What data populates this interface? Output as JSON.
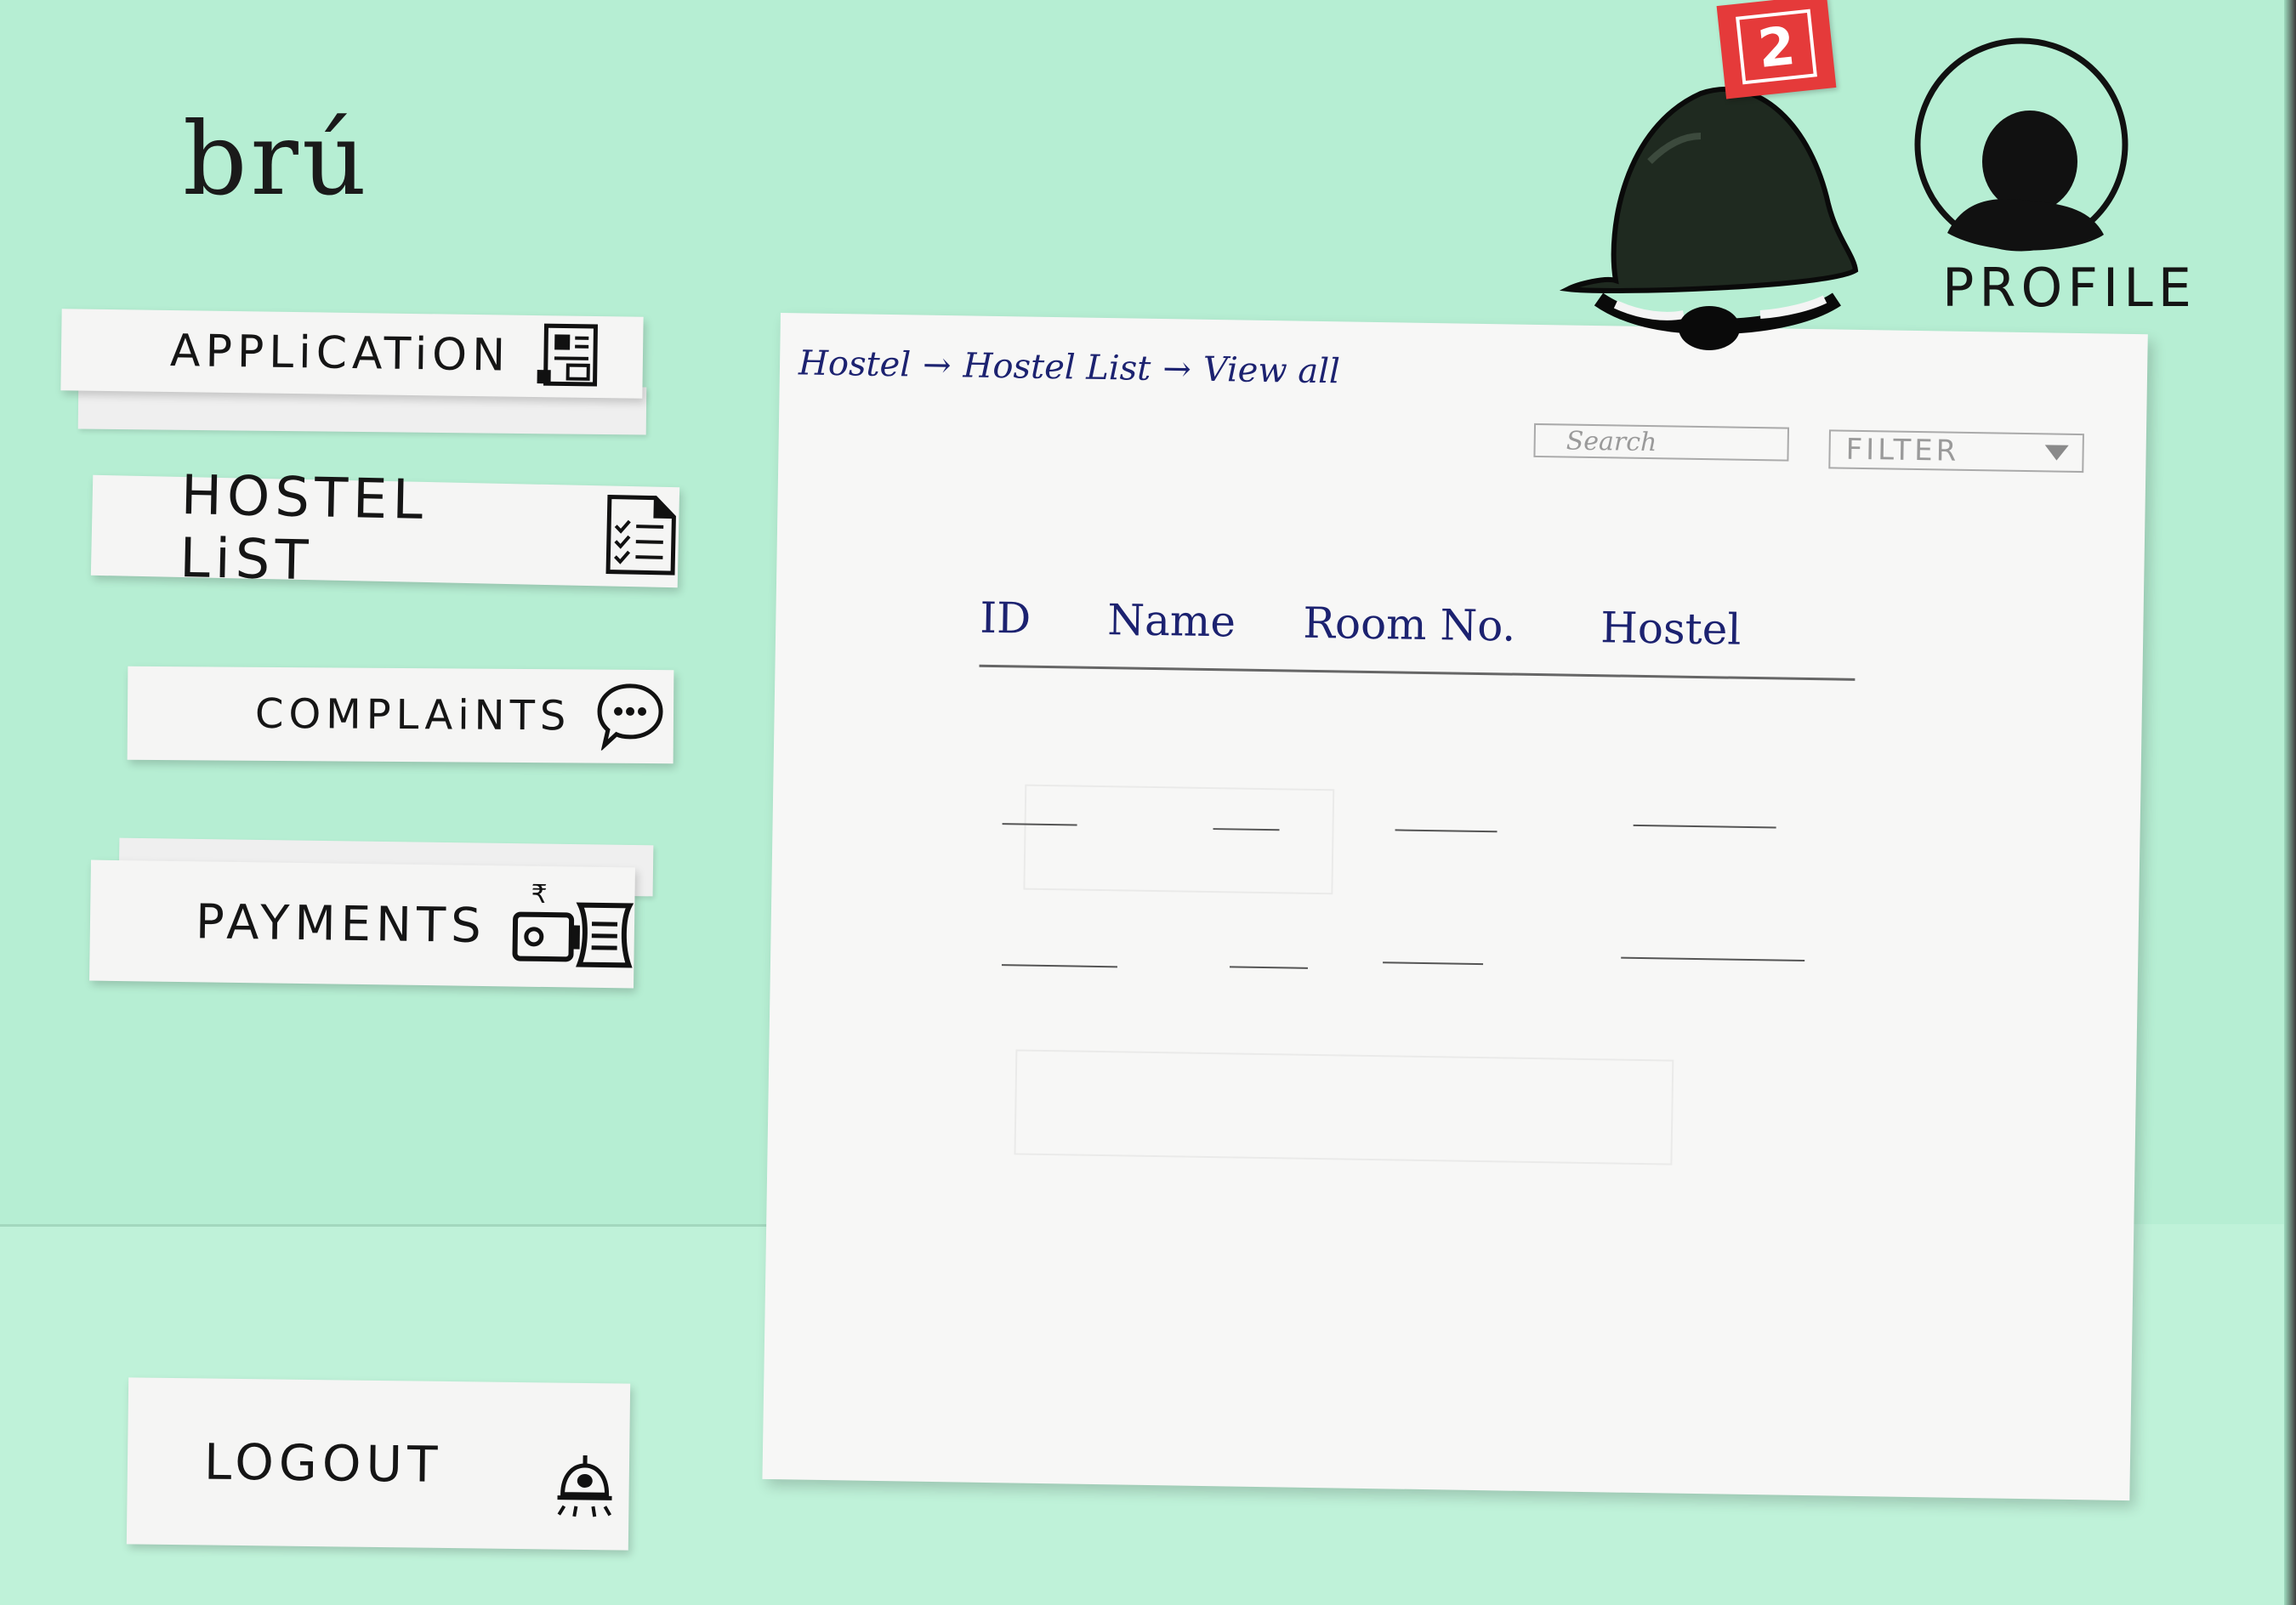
{
  "brand": {
    "logo": "brú"
  },
  "sidebar": {
    "items": [
      {
        "label": "APPLiCATiON",
        "icon": "application-form-icon"
      },
      {
        "label": "HOSTEL LiST",
        "icon": "checklist-icon"
      },
      {
        "label": "COMPLAiNTS",
        "icon": "chat-bubble-icon"
      },
      {
        "label": "PAYMENTS",
        "icon": "money-icon"
      }
    ],
    "logout": {
      "label": "LOGOUT",
      "icon": "logout-bell-icon"
    }
  },
  "header": {
    "notifications": {
      "icon": "bell-icon",
      "count": "2"
    },
    "profile": {
      "label": "PROFILE",
      "icon": "avatar-icon"
    }
  },
  "main": {
    "breadcrumb": [
      "Hostel",
      "Hostel List",
      "View all"
    ],
    "breadcrumb_separator": "→",
    "search": {
      "placeholder": "Search"
    },
    "filter": {
      "label": "FILTER",
      "icon": "caret-down-icon"
    },
    "table": {
      "columns": [
        "ID",
        "Name",
        "Room No.",
        "Hostel"
      ],
      "rows": [
        [
          "—",
          "—",
          "—",
          "—"
        ],
        [
          "—",
          "—",
          "—",
          "—"
        ]
      ]
    }
  }
}
